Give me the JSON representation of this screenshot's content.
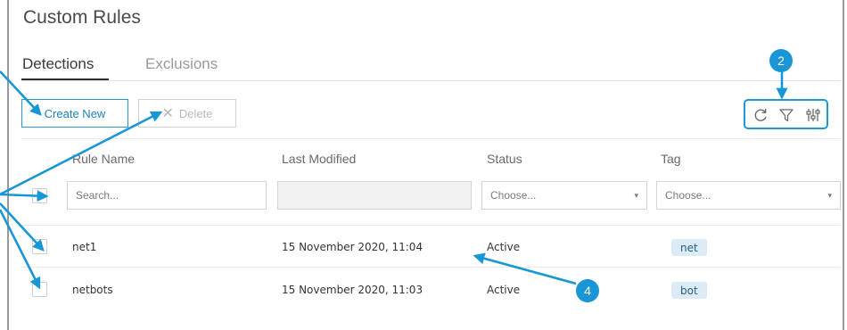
{
  "page": {
    "title": "Custom Rules"
  },
  "tabs": [
    {
      "label": "Detections",
      "active": true
    },
    {
      "label": "Exclusions",
      "active": false
    }
  ],
  "toolbar": {
    "create_label": "Create New",
    "delete_label": "Delete",
    "icons": [
      "refresh-icon",
      "filter-icon",
      "column-settings-icon"
    ]
  },
  "table": {
    "columns": [
      "Rule Name",
      "Last Modified",
      "Status",
      "Tag"
    ],
    "filters": {
      "search_placeholder": "Search...",
      "status_placeholder": "Choose...",
      "tag_placeholder": "Choose..."
    },
    "rows": [
      {
        "name": "net1",
        "modified": "15 November 2020, 11:04",
        "status": "Active",
        "tag": "net"
      },
      {
        "name": "netbots",
        "modified": "15 November 2020, 11:03",
        "status": "Active",
        "tag": "bot"
      }
    ]
  },
  "annotations": {
    "markers": [
      "2",
      "4"
    ],
    "color": "#1896d6"
  },
  "colors": {
    "accent": "#2b93cf",
    "tag_bg": "#dcecf7",
    "annotation": "#1896d6"
  }
}
